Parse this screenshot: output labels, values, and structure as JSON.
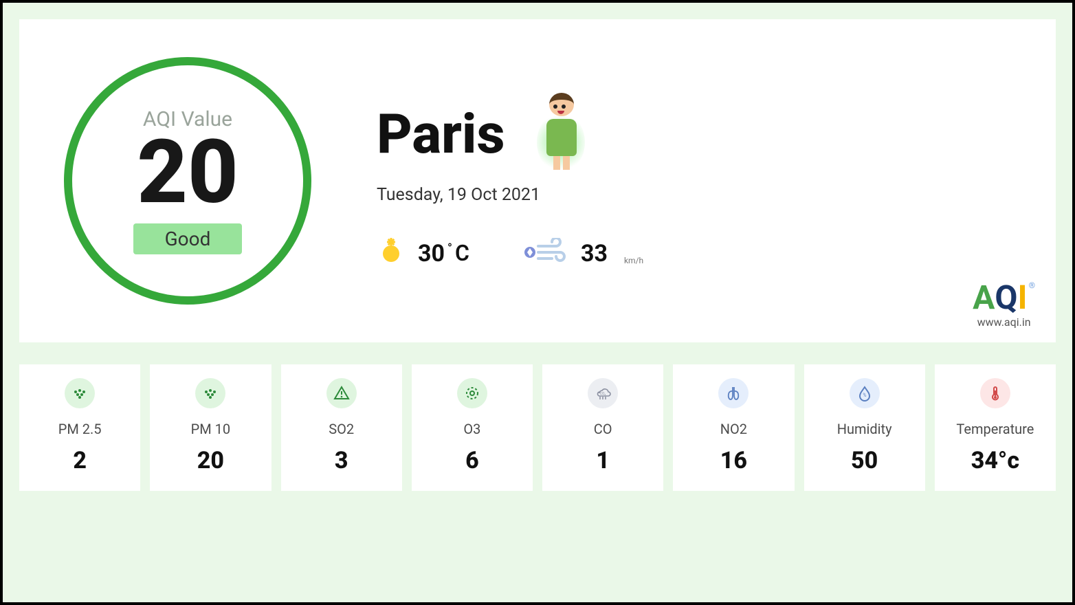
{
  "aqi": {
    "label": "AQI Value",
    "value": "20",
    "rating": "Good"
  },
  "location": {
    "city": "Paris",
    "date": "Tuesday, 19 Oct 2021"
  },
  "weather": {
    "temp_value": "30",
    "temp_unit_deg": "°",
    "temp_unit_c": "C",
    "wind_value": "33",
    "wind_unit": "km/h"
  },
  "brand": {
    "logo_a": "A",
    "logo_q": "Q",
    "logo_i": "I",
    "reg": "®",
    "site": "www.aqi.in"
  },
  "metrics": [
    {
      "label": "PM 2.5",
      "value": "2",
      "icon": "particles",
      "cls": "ic-green",
      "name": "pm25"
    },
    {
      "label": "PM 10",
      "value": "20",
      "icon": "particles",
      "cls": "ic-green",
      "name": "pm10"
    },
    {
      "label": "SO2",
      "value": "3",
      "icon": "warn",
      "cls": "ic-green",
      "name": "so2"
    },
    {
      "label": "O3",
      "value": "6",
      "icon": "ozone",
      "cls": "ic-green",
      "name": "o3"
    },
    {
      "label": "CO",
      "value": "1",
      "icon": "co2",
      "cls": "ic-grey",
      "name": "co"
    },
    {
      "label": "NO2",
      "value": "16",
      "icon": "lungs",
      "cls": "ic-blue",
      "name": "no2"
    },
    {
      "label": "Humidity",
      "value": "50",
      "icon": "drop",
      "cls": "ic-blue",
      "name": "humidity"
    },
    {
      "label": "Temperature",
      "value": "34°c",
      "icon": "thermo",
      "cls": "ic-red",
      "name": "temperature"
    }
  ]
}
